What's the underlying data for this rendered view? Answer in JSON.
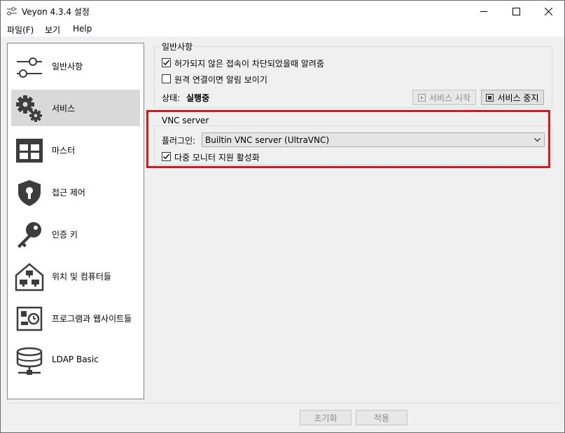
{
  "window": {
    "title": "Veyon  4.3.4 설정",
    "icon": "sliders-icon"
  },
  "menu": [
    {
      "label": "파일(F)"
    },
    {
      "label": "보기"
    },
    {
      "label": "Help"
    }
  ],
  "sidebar": {
    "items": [
      {
        "label": "일반사항",
        "icon": "sliders-icon",
        "active": false
      },
      {
        "label": "서비스",
        "icon": "gears-icon",
        "active": true
      },
      {
        "label": "마스터",
        "icon": "grid-icon",
        "active": false
      },
      {
        "label": "접근 제어",
        "icon": "shield-lock-icon",
        "active": false
      },
      {
        "label": "인증 키",
        "icon": "key-icon",
        "active": false
      },
      {
        "label": "위치 및 컴퓨터들",
        "icon": "house-computers-icon",
        "active": false
      },
      {
        "label": "프로그램과 웹사이트들",
        "icon": "app-clock-icon",
        "active": false
      },
      {
        "label": "LDAP Basic",
        "icon": "database-icon",
        "active": false
      }
    ]
  },
  "general": {
    "title": "일반사항",
    "checkbox1": {
      "label": "허가되지 않은 접속이 차단되었을때 알려줌",
      "checked": true
    },
    "checkbox2": {
      "label": "원격 연결이면 알림 보이기",
      "checked": false
    },
    "status_label": "상태:",
    "status_value": "실행중",
    "start_button": "서비스 시작",
    "stop_button": "서비스 중지"
  },
  "vnc": {
    "title": "VNC server",
    "plugin_label": "플러그인:",
    "plugin_value": "Builtin VNC server (UltraVNC)",
    "multimonitor": {
      "label": "다중 모니터 지원 활성화",
      "checked": true
    }
  },
  "footer": {
    "reset_button": "초기화",
    "apply_button": "적용"
  },
  "colors": {
    "highlight": "#d7191f",
    "active_item": "#d9d9d9",
    "icon": "#3c3c3c"
  }
}
